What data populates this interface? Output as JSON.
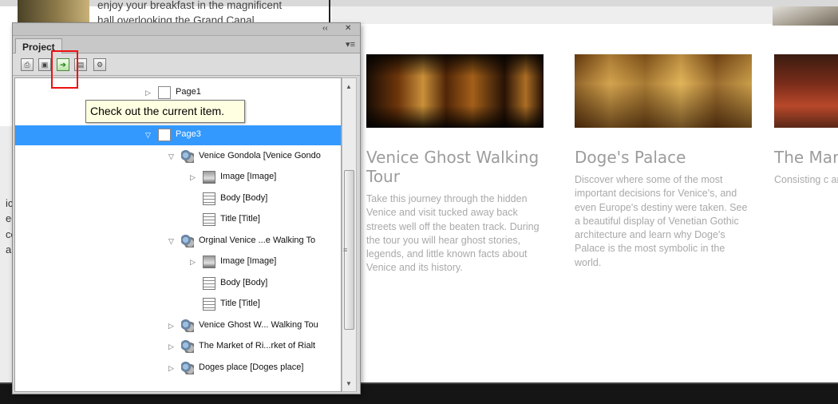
{
  "page": {
    "top_text_line1": "enjoy your breakfast in the magnificent",
    "top_text_line2": "hall overlooking the Grand Canal",
    "left_fragments": [
      "ic",
      "ed",
      "ce",
      "a"
    ],
    "cards": [
      {
        "title": "Venice Ghost Walking Tour",
        "description": "Take this journey through the hidden Venice and visit tucked away back streets well off the beaten track. During the tour you will hear ghost stories, legends, and little known facts about Venice and its history."
      },
      {
        "title": "Doge's Palace",
        "description": "Discover where some of the most important decisions for Venice's, and even Europe's destiny were taken. See a beautiful display of Venetian Gothic architecture and learn why Doge's Palace is the most symbolic in the world."
      },
      {
        "title": "The Mark",
        "description": "Consisting c and Pesche Rialto still re typical Vene for centuries Venetians d get together"
      }
    ]
  },
  "panel": {
    "tab_label": "Project",
    "collapse_glyph": "‹‹",
    "close_glyph": "✕",
    "menu_glyph": "▾≡",
    "toolbar": [
      {
        "name": "toolbar-btn-1",
        "glyph": "⎙"
      },
      {
        "name": "toolbar-btn-2",
        "glyph": "▣"
      },
      {
        "name": "check-out-button",
        "glyph": "➔"
      },
      {
        "name": "toolbar-btn-4",
        "glyph": "▤"
      },
      {
        "name": "toolbar-btn-5",
        "glyph": "⚙"
      }
    ],
    "tooltip": "Check out the current item.",
    "tree": [
      {
        "label": "Page1",
        "type": "page",
        "indent": 1,
        "expander": "collapsed"
      },
      {
        "label": "Page2",
        "type": "page",
        "indent": 1,
        "expander": "collapsed"
      },
      {
        "label": "Page3",
        "type": "page",
        "indent": 1,
        "expander": "expanded",
        "selected": true
      },
      {
        "label": "Venice Gondola [Venice Gondo",
        "type": "component",
        "indent": 2,
        "expander": "expanded"
      },
      {
        "label": "Image [Image]",
        "type": "image",
        "indent": 3,
        "expander": "collapsed"
      },
      {
        "label": "Body [Body]",
        "type": "field",
        "indent": 3,
        "expander": "none"
      },
      {
        "label": "Title [Title]",
        "type": "field",
        "indent": 3,
        "expander": "none"
      },
      {
        "label": "Orginal Venice ...e Walking To",
        "type": "component",
        "indent": 2,
        "expander": "expanded"
      },
      {
        "label": "Image [Image]",
        "type": "image",
        "indent": 3,
        "expander": "collapsed"
      },
      {
        "label": "Body [Body]",
        "type": "field",
        "indent": 3,
        "expander": "none"
      },
      {
        "label": "Title [Title]",
        "type": "field",
        "indent": 3,
        "expander": "none"
      },
      {
        "label": "Venice Ghost W... Walking Tou",
        "type": "component",
        "indent": 2,
        "expander": "collapsed"
      },
      {
        "label": "The Market of Ri...rket of Rialt",
        "type": "component",
        "indent": 2,
        "expander": "collapsed"
      },
      {
        "label": "Doges place [Doges place]",
        "type": "component",
        "indent": 2,
        "expander": "collapsed"
      }
    ]
  }
}
